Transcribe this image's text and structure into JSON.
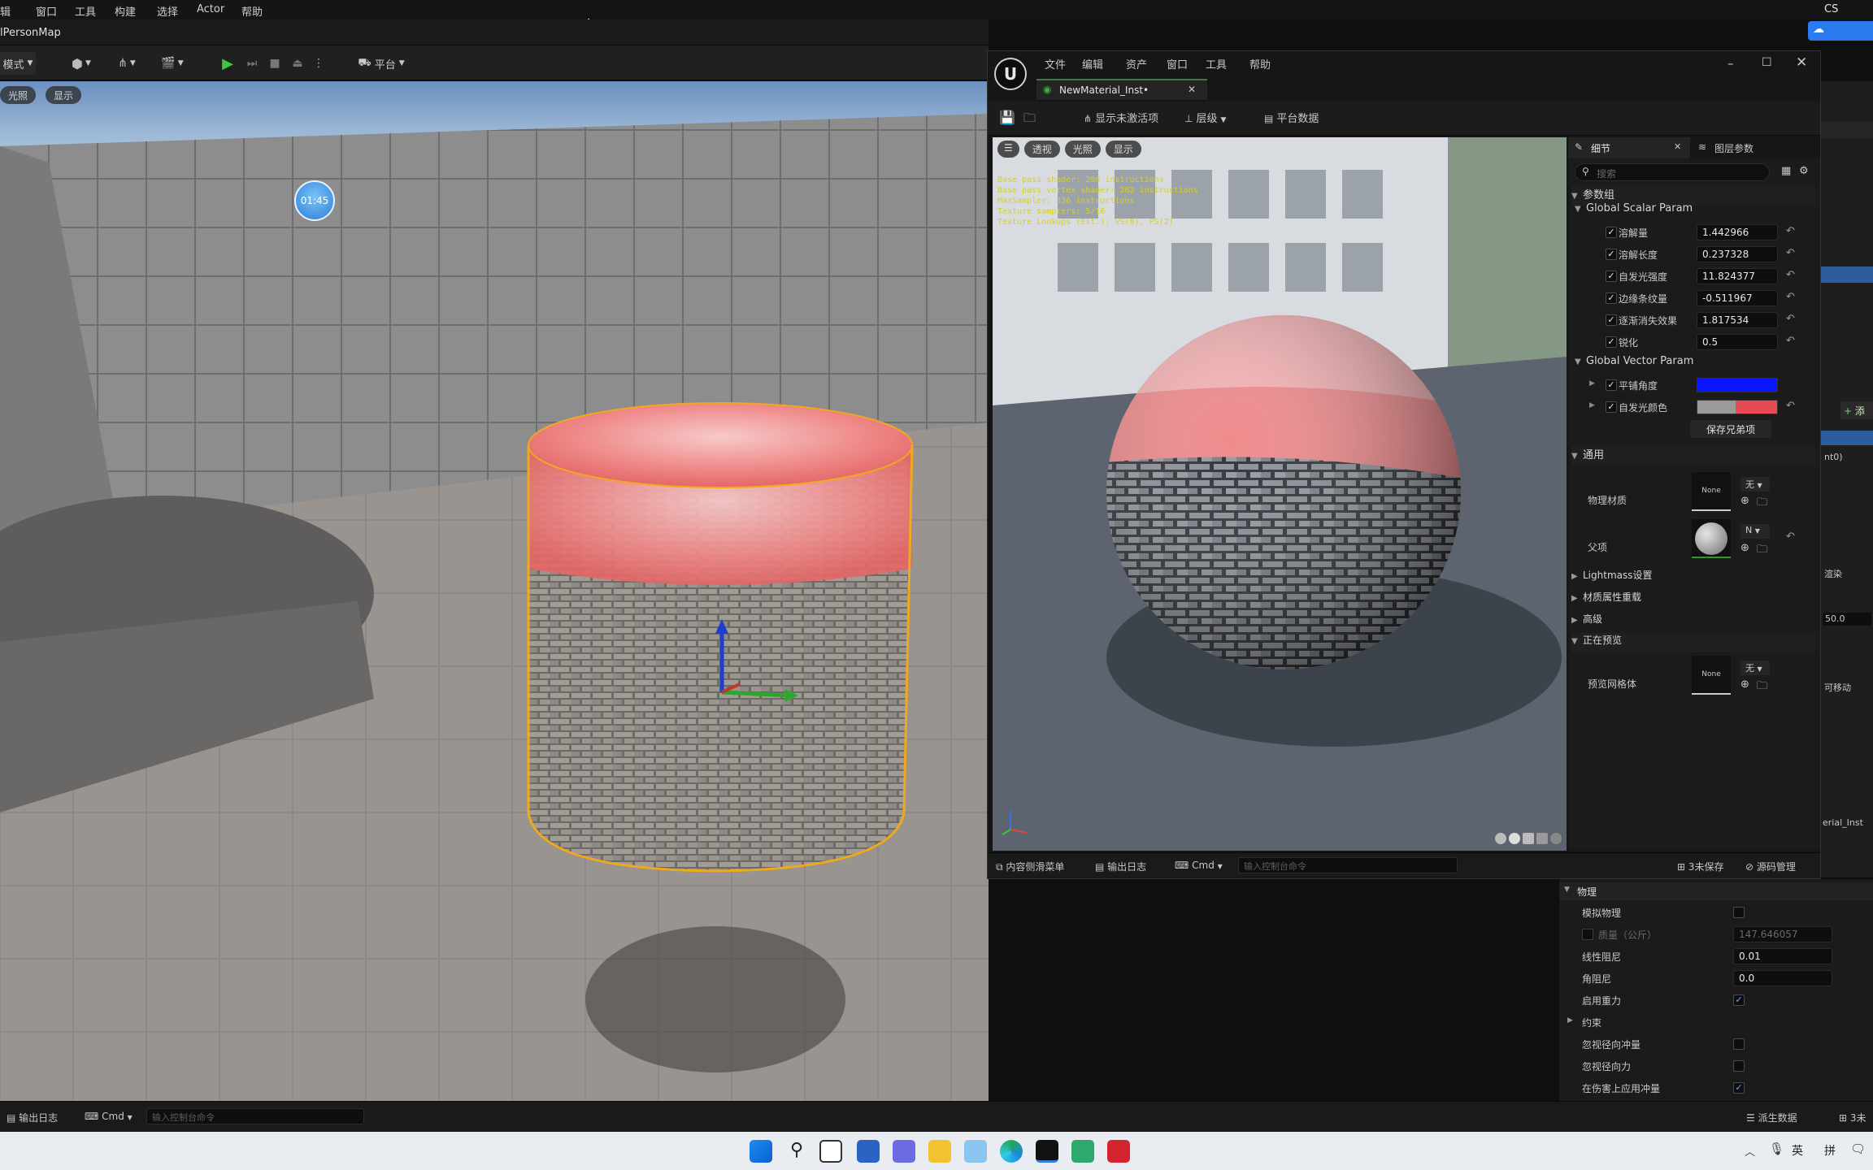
{
  "main_menu": {
    "items": [
      "辑",
      "窗口",
      "工具",
      "构建",
      "选择",
      "Actor",
      "帮助"
    ],
    "right_text": "CS"
  },
  "map_tab": {
    "label": "lPersonMap"
  },
  "main_toolbar": {
    "mode_label": "模式",
    "platform_label": "平台"
  },
  "viewport": {
    "chip_lighting": "光照",
    "chip_show": "显示",
    "timer": "01:45"
  },
  "material_editor": {
    "menu": [
      "文件",
      "编辑",
      "资产",
      "窗口",
      "工具",
      "帮助"
    ],
    "tab_title": "NewMaterial_Inst•",
    "toolbar": {
      "show_inactive": "显示未激活项",
      "hierarchy": "层级",
      "platform_data": "平台数据"
    },
    "viewport_chips": {
      "perspective": "透视",
      "lighting": "光照",
      "show": "显示"
    },
    "stats": [
      "Base pass shader: 286 instructions",
      "Base pass vertex shader: 262 instructions",
      "MaxSampler: 336 instructions",
      "Texture samplers: 5/16",
      "Texture Lookups (Est.): VS(8), PS(2)"
    ],
    "bottom": {
      "content_drawer": "内容侧滑菜单",
      "output_log": "输出日志",
      "cmd": "Cmd",
      "console_placeholder": "输入控制台命令",
      "unsaved": "3未保存",
      "source_control": "源码管理"
    }
  },
  "details": {
    "tab_details": "细节",
    "tab_layers": "图层参数",
    "search_placeholder": "搜索",
    "group_params": "参数组",
    "scalar_group": "Global Scalar Param",
    "scalars": [
      {
        "label": "溶解量",
        "value": "1.442966"
      },
      {
        "label": "溶解长度",
        "value": "0.237328"
      },
      {
        "label": "自发光强度",
        "value": "11.824377"
      },
      {
        "label": "边缘条纹量",
        "value": "-0.511967"
      },
      {
        "label": "逐渐消失效果",
        "value": "1.817534"
      },
      {
        "label": "锐化",
        "value": "0.5"
      }
    ],
    "vector_group": "Global Vector Param",
    "vectors": [
      {
        "label": "平铺角度",
        "color": "#0a14ff"
      },
      {
        "label": "自发光颜色",
        "color": "#e84a55"
      }
    ],
    "save_siblings": "保存兄弟项",
    "general": "通用",
    "phys_material": "物理材质",
    "none": "None",
    "none_short": "无",
    "n_short": "N",
    "parent": "父项",
    "lightmass": "Lightmass设置",
    "mat_override": "材质属性重载",
    "advanced": "高级",
    "previewing": "正在预览",
    "preview_mesh": "预览网格体"
  },
  "right_strip": {
    "add_label": "添",
    "value_500": "50.0",
    "movable": "可移动",
    "inst_label": "erial_Inst",
    "nt0": "nt0)",
    "render": "渲染"
  },
  "physics": {
    "header": "物理",
    "simulate": "模拟物理",
    "mass_label": "质量（公斤）",
    "mass_value": "147.646057",
    "linear_damping": "线性阻尼",
    "linear_damping_value": "0.01",
    "angular_damping": "角阻尼",
    "angular_damping_value": "0.0",
    "enable_gravity": "启用重力",
    "constraints": "约束",
    "ignore_radial_impulse": "忽视径向冲量",
    "ignore_radial_force": "忽视径向力",
    "apply_impulse_on_damage": "在伤害上应用冲量"
  },
  "status_bar": {
    "output_log": "输出日志",
    "cmd": "Cmd",
    "console_placeholder": "输入控制台命令",
    "derived_data": "派生数据",
    "unsaved": "3未"
  },
  "taskbar": {
    "ime_lang": "英",
    "ime_mode": "拼"
  }
}
